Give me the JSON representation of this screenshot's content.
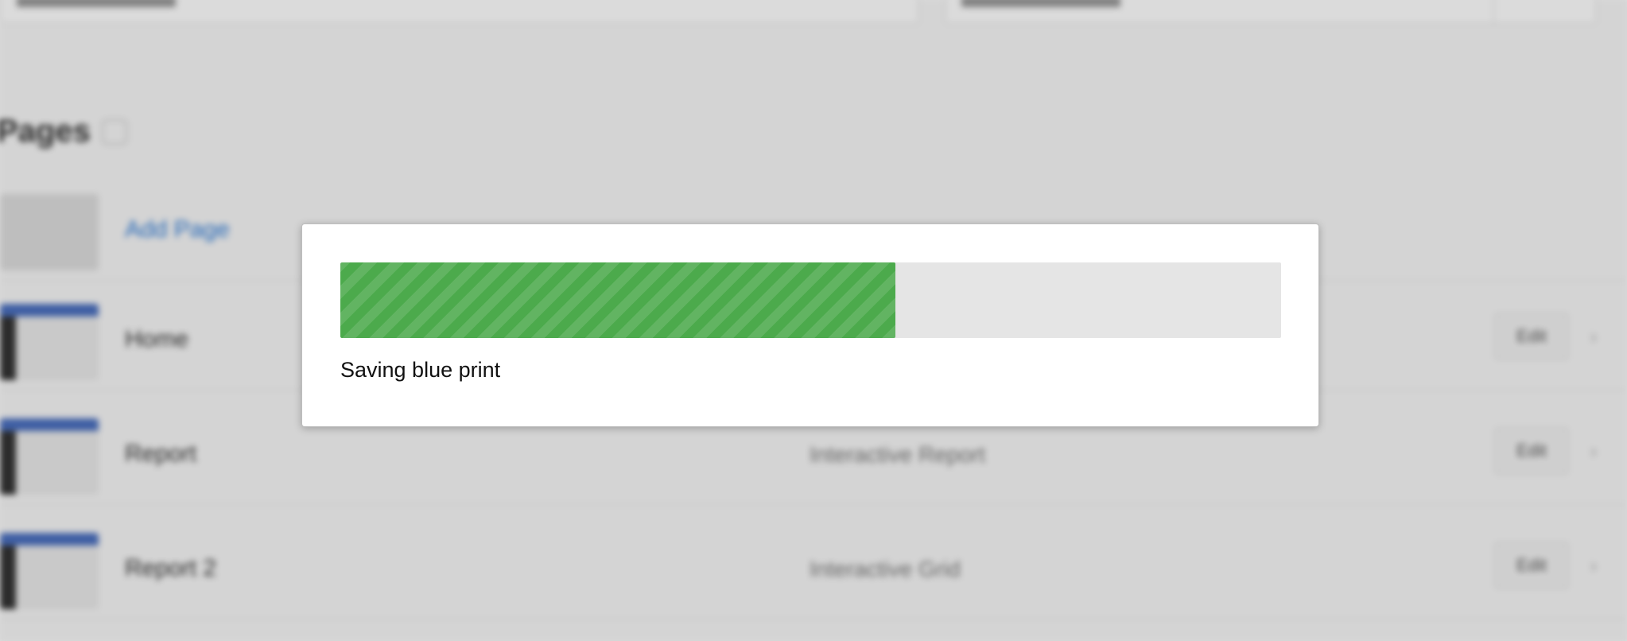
{
  "background": {
    "section_title": "Pages",
    "rows": [
      {
        "label": "Add Page",
        "description": "",
        "edit_label": ""
      },
      {
        "label": "Home",
        "description": "",
        "edit_label": "Edit"
      },
      {
        "label": "Report",
        "description": "Interactive Report",
        "edit_label": "Edit"
      },
      {
        "label": "Report 2",
        "description": "Interactive Grid",
        "edit_label": "Edit"
      }
    ]
  },
  "modal": {
    "progress": {
      "fraction": 0.59,
      "color": "#4caa4c",
      "track_color": "#e5e5e5",
      "message": "Saving blue print"
    }
  }
}
